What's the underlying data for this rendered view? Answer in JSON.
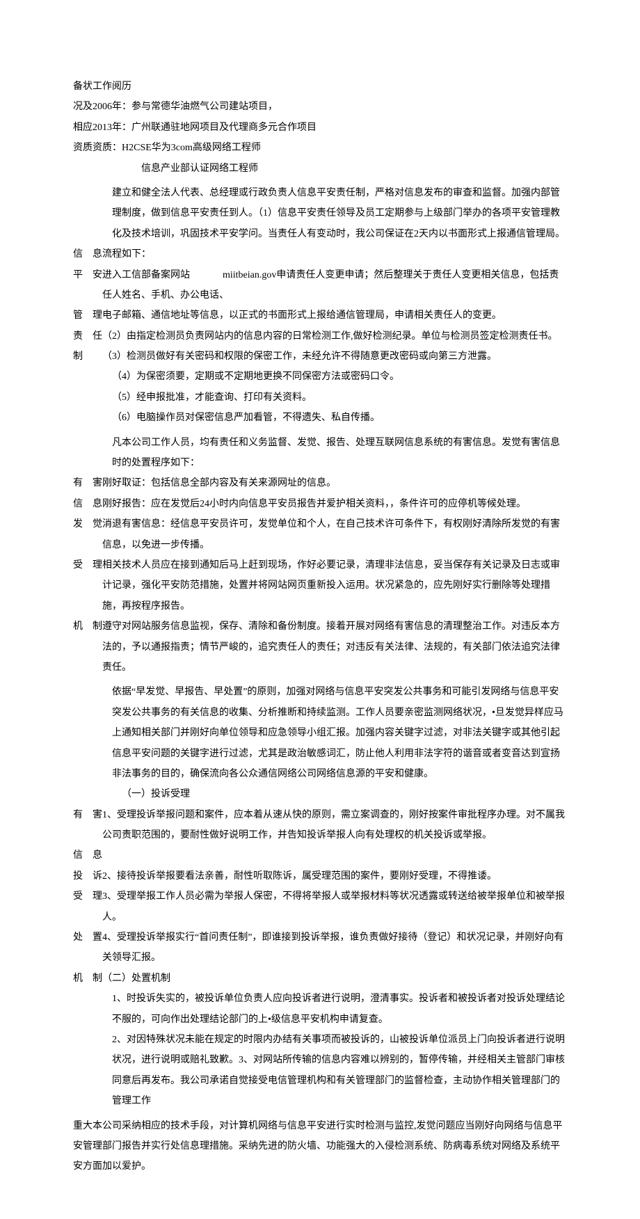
{
  "header": {
    "line1_left": "备状",
    "line1_right": "工作阅历",
    "line2_left": "况及",
    "line2_right": "2006年：参与常德华油燃气公司建站项目，",
    "line3_left": "相应",
    "line3_right": "2013年：广州联通驻地网项目及代理商多元合作项目",
    "line4_left": "资质",
    "line4_right": "资质：H2CSE华为3com高级网络工程师",
    "line5": "信息产业部认证网络工程师"
  },
  "section1": {
    "p1": "建立和健全法人代表、总经理或行政负责人信息平安责任制，严格对信息发布的审查和监督。加强内部管理制度，做到信息平安责任到人。（1）信息平安责任领导及员工定期参与上级部门举办的各项平安管理教化及技术培训，巩固技术平安学问。当责任人有变动时，我公司保证在2天内以书面形式上报通信管理局。",
    "label1": "信息",
    "p2": "流程如下：",
    "label2": "平安",
    "p3_a": "进入工信部备案网站",
    "p3_b": "miitbeian.gov申请责任人变更申请；然后整理关于责任人变更相关信息，包括责任人姓名、手机、办公电话、",
    "label3": "管理",
    "p4": "电子邮箱、通信地址等信息，以正式的书面形式上报给通信管理局，申请相关责任人的变更。",
    "label4": "责任",
    "p5": "（2）由指定检测员负责网站内的信息内容的日常检测工作,做好检测纪录。单位与检测员签定检测责任书。",
    "label5": "制",
    "p6": "（3）检测员做好有关密码和权限的保密工作，未经允许不得随意更改密码或向第三方泄露。",
    "p7": "（4）为保密须要，定期或不定期地更换不同保密方法或密码口令。",
    "p8": "（5）经申报批准，才能查询、打印有关资料。",
    "p9": "（6）电脑操作员对保密信息严加看管，不得遗失、私自传播。"
  },
  "section2": {
    "p1": "凡本公司工作人员，均有责任和义务监督、发觉、报告、处理互联网信息系统的有害信息。发觉有害信息时的处置程序如下：",
    "label1": "有害",
    "p2": "刚好取证：包括信息全部内容及有关来源网址的信息。",
    "label2": "信息",
    "p3": "刚好报告：应在发觉后24小时内向信息平安员报告并爱护相关资料，，条件许可的应停机等候处理。",
    "label3": "发觉",
    "p4": "消退有害信息：经信息平安员许可，发觉单位和个人，在自己技术许可条件下，有权刚好清除所发觉的有害信息，以免进一步传播。",
    "label4": "受理",
    "p5": "相关技术人员应在接到通知后马上赶到现场，作好必要记录，清理非法信息，妥当保存有关记录及日志或审计记录，强化平安防范措施，处置并将网站网页重新投入运用。状况紧急的，应先刚好实行删除等处理措施，再按程序报告。",
    "label5": "机制",
    "p6": "遵守对网站服务信息监视，保存、清除和备份制度。接着开展对网络有害信息的清理整治工作。对违反本方法的，予以通报指责；情节严峻的，追究责任人的责任；对违反有关法律、法规的，有关部门依法追究法律责任。"
  },
  "section3": {
    "p1": "依据“早发觉、早报告、早处置”的原则，加强对网络与信息平安突发公共事务和可能引发网络与信息平安突发公共事务的有关信息的收集、分析推断和持续监测。工作人员要亲密监测网络状况，•旦发觉异样应马上通知相关部门并刚好向单位领导和应急领导小组汇报。加强内容关键字过滤，对非法关键字或其他引起信息平安问题的关键字进行过滤，尤其是政治敏感词汇，防止他人利用非法字符的谐音或者变音达到宣扬非法事务的目的，确保流向各公众通信网络公司网络信息源的平安和健康。",
    "subhead1": "（一）投诉受理",
    "label1": "有害",
    "p2": "1、受理投诉举报问题和案件，应本着从速从快的原则，需立案调查的，刚好按案件审批程序办理。对不属我公司责职范围的，要耐性做好说明工作，并告知投诉举报人向有处理权的机关投诉或举报。",
    "label2": "信息",
    "label3": "投诉",
    "p3": "2、接待投诉举报要看法亲善，耐性听取陈诉，属受理范围的案件，要刚好受理，不得推诿。",
    "label4": "受理",
    "p4": "3、受理举报工作人员必需为举报人保密，不得将举报人或举报材料等状况透露或转送给被举报单位和被举报人。",
    "label5": "处置",
    "p5": "4、受理投诉举报实行“首问责任制”，即谁接到投诉举报，谁负责做好接待（登记）和状况记录，并刚好向有关领导汇报。",
    "label6": "机制",
    "subhead2": "（二）处置机制",
    "p6": "1、时投诉失实的，被投诉单位负责人应向投诉者进行说明，澄清事实。投诉者和被投诉者对投诉处理结论不服的，可向作出处理结论部门的上•级信息平安机构申请复查。",
    "p7": "2、对因特殊状况未能在规定的时限内办结有关事项而被投诉的，山被投诉单位派员上门向投诉者进行说明状况，进行说明或赔礼致歉。3、对网站所传输的信息内容难以辨别的，暂停传输，并经相关主管部门审核同意后再发布。我公司承诺自觉接受电信管理机构和有关管理部门的监督检查，主动协作相关管理部门的管理工作"
  },
  "section4": {
    "label": "重大",
    "p1": "本公司采纳相应的技术手段，对计算机网络与信息平安进行实时检测与监控,发觉问题应当刚好向网络与信息平安管理部门报告并实行处信息理措施。采纳先进的防火墙、功能强大的入侵检测系统、防病毒系统对网络及系统平安方面加以爱护。"
  }
}
